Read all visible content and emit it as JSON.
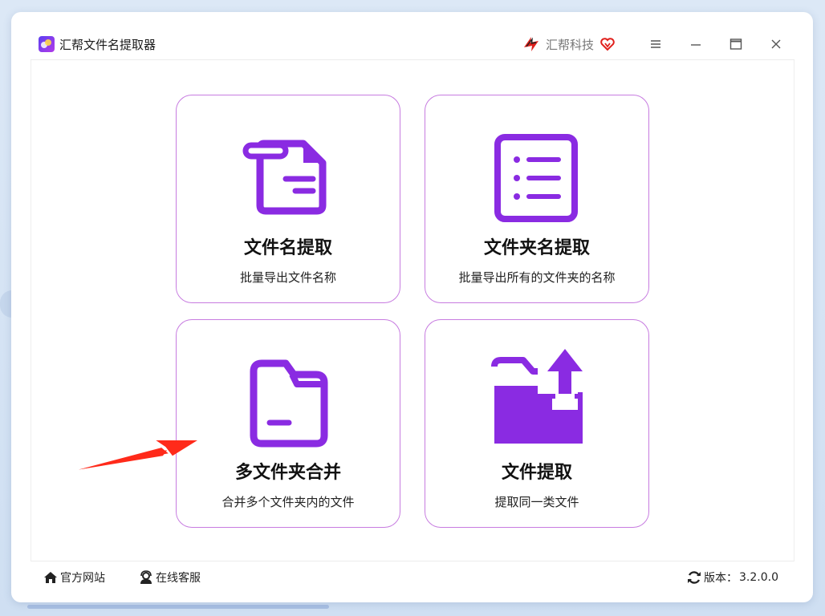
{
  "app": {
    "title": "汇帮文件名提取器",
    "brand_name": "汇帮科技"
  },
  "window_controls": [
    "menu",
    "minimize",
    "maximize",
    "close"
  ],
  "colors": {
    "accent": "#8a2be2",
    "card_border": "#c77ce0",
    "arrow": "#ff2a1a",
    "brand_red": "#e0201c"
  },
  "cards": [
    {
      "title": "文件名提取",
      "description": "批量导出文件名称",
      "icon": "file-document-icon"
    },
    {
      "title": "文件夹名提取",
      "description": "批量导出所有的文件夹的名称",
      "icon": "list-document-icon"
    },
    {
      "title": "多文件夹合并",
      "description": "合并多个文件夹内的文件",
      "icon": "folder-icon"
    },
    {
      "title": "文件提取",
      "description": "提取同一类文件",
      "icon": "folder-export-icon"
    }
  ],
  "footer": {
    "website_label": "官方网站",
    "support_label": "在线客服",
    "version_label": "版本：",
    "version_value": "3.2.0.0"
  }
}
